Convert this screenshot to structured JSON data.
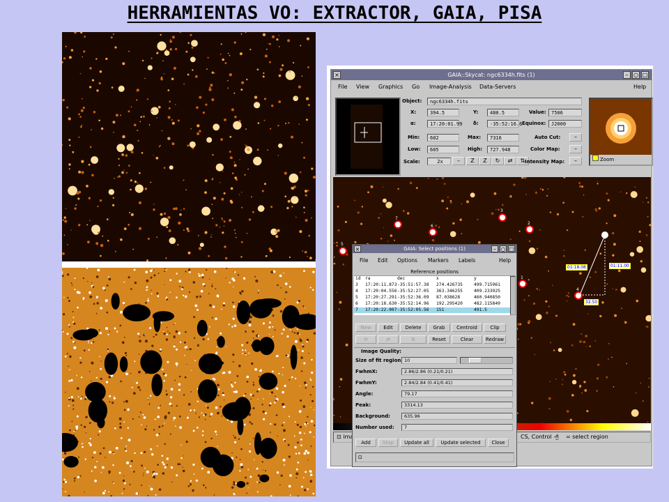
{
  "slide": {
    "title": "HERRAMIENTAS VO: EXTRACTOR, GAIA, PISA"
  },
  "gaia": {
    "window_title": "GAIA::Skycat: ngc6334h.fits (1)",
    "menu": [
      "File",
      "View",
      "Graphics",
      "Go",
      "Image-Analysis",
      "Data-Servers"
    ],
    "help": "Help",
    "fields": {
      "object_label": "Object:",
      "object_value": "ngc6334h.fits",
      "x_label": "X:",
      "x_value": "394.5",
      "y_label": "Y:",
      "y_value": "480.5",
      "value_label": "Value:",
      "value_value": "7506",
      "ra_label": "α:",
      "ra_value": "17:20:01.99",
      "dec_label": "δ:",
      "dec_value": "-35:52:16.6",
      "equinox_label": "Equinox:",
      "equinox_value": "J2000",
      "min_label": "Min:",
      "min_value": "602",
      "max_label": "Max:",
      "max_value": "7316",
      "low_label": "Low:",
      "low_value": "605",
      "high_label": "High:",
      "high_value": "727.948",
      "scale_label": "Scale:",
      "scale_value": "2x",
      "autocut_label": "Auto Cut:",
      "colormap_label": "Color Map:",
      "intensitymap_label": "Intensity Map:"
    },
    "zoom_label": "Zoom",
    "status_text": "ima",
    "status_text_right": "CS, Control -",
    "status_text_right2": "= select region",
    "markers": [
      "7",
      "6",
      "3",
      "2",
      "5",
      "1",
      "4"
    ],
    "tags": [
      "01:18.08",
      "01:11.00",
      "32.50"
    ]
  },
  "select_positions": {
    "title": "GAIA: Select positions (1)",
    "menu": [
      "File",
      "Edit",
      "Options",
      "Markers",
      "Labels"
    ],
    "help": "Help",
    "section": "Reference positions",
    "columns": [
      "id",
      "ra",
      "dec",
      "x",
      "y"
    ],
    "rows": [
      [
        "3",
        "17:20:11.873",
        "-35:51:57.38",
        "274.426735",
        "499.715961"
      ],
      [
        "4",
        "17:20:04.556",
        "-35:52:27.05",
        "363.346255",
        "409.233925"
      ],
      [
        "5",
        "17:20:27.291",
        "-35:52:36.09",
        "87.038628",
        "460.940850"
      ],
      [
        "6",
        "17:20:18.630",
        "-35:52:14.96",
        "192.295420",
        "482.115849"
      ],
      [
        "7",
        "17:20:22.007",
        "-35:52:05.56",
        "151",
        "491.5"
      ]
    ],
    "buttons_row1": [
      "New",
      "Edit",
      "Delete",
      "Grab",
      "Centroid",
      "Clip"
    ],
    "buttons_row2": [
      "Reset",
      "Clear",
      "Redraw"
    ],
    "image_quality_label": "Image Quality:",
    "quality": [
      {
        "label": "Size of fit region:",
        "value": "10"
      },
      {
        "label": "FwhmX:",
        "value": "2.86/2.86 (0.21/0.21)"
      },
      {
        "label": "FwhmY:",
        "value": "2.84/2.84 (0.41/0.41)"
      },
      {
        "label": "Angle:",
        "value": "79.17"
      },
      {
        "label": "Peak:",
        "value": "3314.13"
      },
      {
        "label": "Background:",
        "value": "635.96"
      },
      {
        "label": "Number used:",
        "value": "7"
      }
    ],
    "bottom_buttons": [
      "Add",
      "Stop",
      "Update all",
      "Update selected",
      "Close"
    ]
  },
  "colors": {
    "background": "#c6c6f4",
    "marker": "#e00000"
  }
}
